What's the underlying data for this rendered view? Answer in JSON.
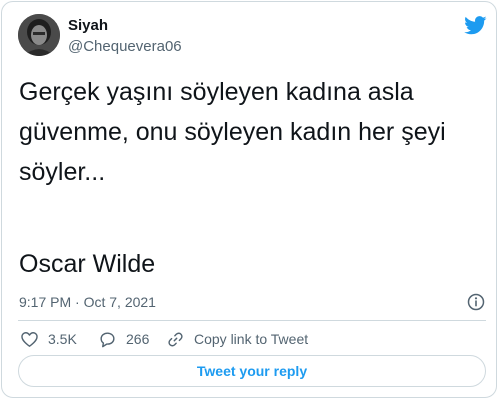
{
  "author": {
    "name": "Siyah",
    "handle": "@Chequevera06"
  },
  "tweet": {
    "text": "Gerçek yaşını söyleyen kadına asla\ngüvenme, onu söyleyen kadın her şeyi\nsöyler...",
    "attribution": "Oscar Wilde",
    "timestamp": "9:17 PM · Oct 7, 2021"
  },
  "actions": {
    "likes": "3.5K",
    "replies": "266",
    "copy_link": "Copy link to Tweet"
  },
  "reply_button": "Tweet your reply",
  "colors": {
    "brand": "#1d9bf0",
    "text": "#0f1419",
    "muted": "#536471",
    "border": "#cfd9de"
  }
}
